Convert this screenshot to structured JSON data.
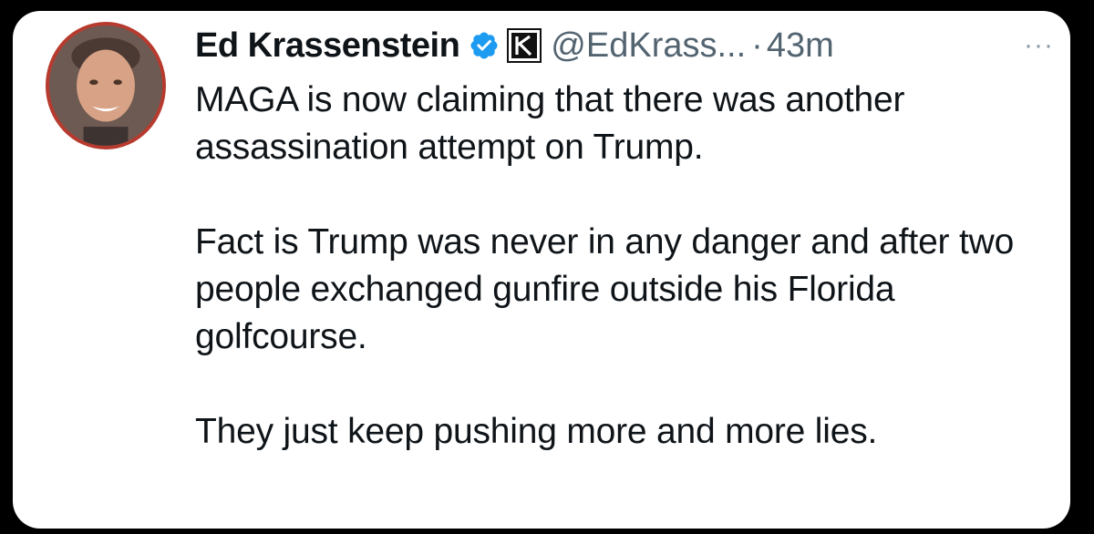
{
  "tweet": {
    "author_name": "Ed Krassenstein",
    "handle": "@EdKrass...",
    "separator": "·",
    "timestamp": "43m",
    "more_label": "···",
    "verified_icon": "verified-badge-icon",
    "affiliation_icon": "k-affiliation-icon",
    "paragraphs": [
      "MAGA is now claiming that there was another assassination attempt on Trump.",
      "Fact is Trump was never in any danger and after two people exchanged gunfire outside his Florida golfcourse.",
      "They just keep pushing more and more lies."
    ]
  },
  "colors": {
    "background": "#000000",
    "card": "#ffffff",
    "text": "#0f1419",
    "secondary": "#536471",
    "verified": "#1d9bf0",
    "avatar_ring": "#b73a2e"
  }
}
